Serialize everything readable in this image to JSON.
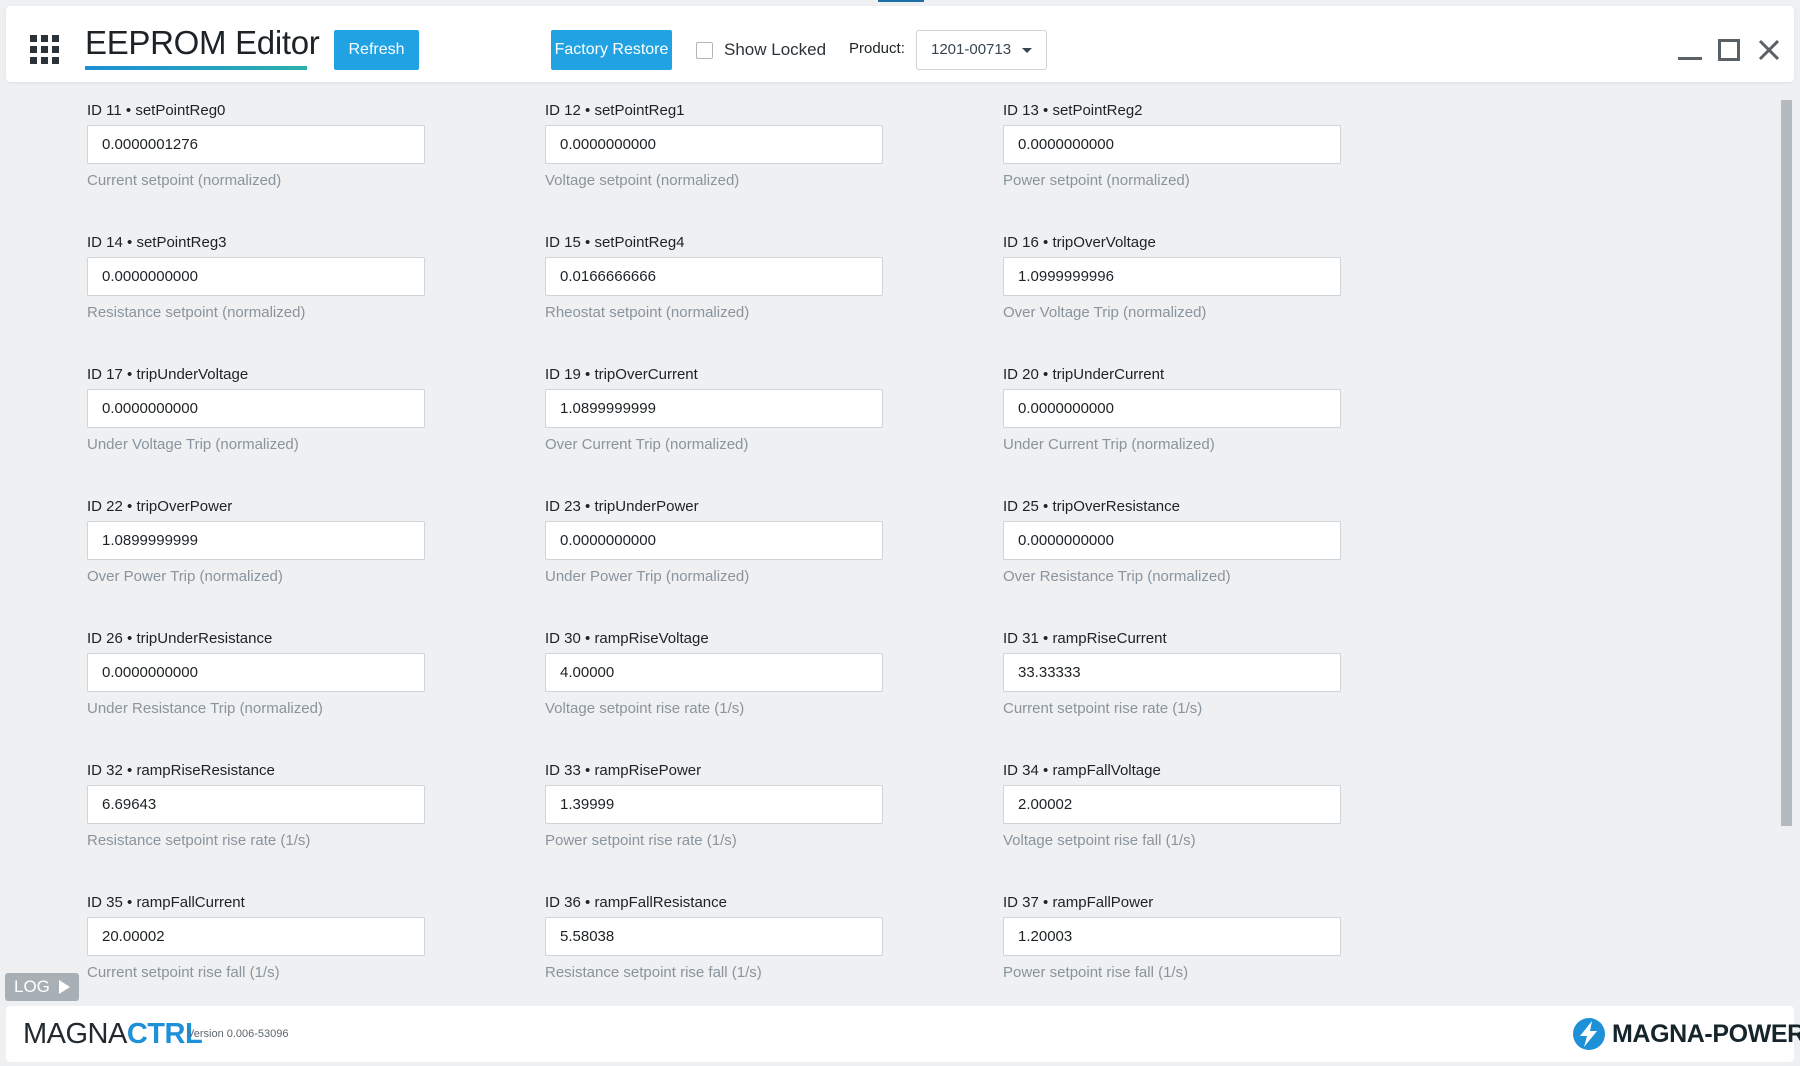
{
  "header": {
    "title": "EEPROM Editor",
    "refresh_label": "Refresh",
    "factory_restore_label": "Factory Restore",
    "show_locked_label": "Show Locked",
    "show_locked_checked": false,
    "product_label": "Product:",
    "product_value": "1201-00713"
  },
  "fields": [
    {
      "label": "ID 11 • setPointReg0",
      "value": "0.0000001276",
      "help": "Current setpoint (normalized)"
    },
    {
      "label": "ID 12 • setPointReg1",
      "value": "0.0000000000",
      "help": "Voltage setpoint (normalized)"
    },
    {
      "label": "ID 13 • setPointReg2",
      "value": "0.0000000000",
      "help": "Power setpoint (normalized)"
    },
    {
      "label": "ID 14 • setPointReg3",
      "value": "0.0000000000",
      "help": "Resistance setpoint (normalized)"
    },
    {
      "label": "ID 15 • setPointReg4",
      "value": "0.0166666666",
      "help": "Rheostat setpoint (normalized)"
    },
    {
      "label": "ID 16 • tripOverVoltage",
      "value": "1.0999999996",
      "help": "Over Voltage Trip (normalized)"
    },
    {
      "label": "ID 17 • tripUnderVoltage",
      "value": "0.0000000000",
      "help": "Under Voltage Trip (normalized)"
    },
    {
      "label": "ID 19 • tripOverCurrent",
      "value": "1.0899999999",
      "help": "Over Current Trip (normalized)"
    },
    {
      "label": "ID 20 • tripUnderCurrent",
      "value": "0.0000000000",
      "help": "Under Current Trip (normalized)"
    },
    {
      "label": "ID 22 • tripOverPower",
      "value": "1.0899999999",
      "help": "Over Power Trip (normalized)"
    },
    {
      "label": "ID 23 • tripUnderPower",
      "value": "0.0000000000",
      "help": "Under Power Trip (normalized)"
    },
    {
      "label": "ID 25 • tripOverResistance",
      "value": "0.0000000000",
      "help": "Over Resistance Trip (normalized)"
    },
    {
      "label": "ID 26 • tripUnderResistance",
      "value": "0.0000000000",
      "help": "Under Resistance Trip (normalized)"
    },
    {
      "label": "ID 30 • rampRiseVoltage",
      "value": "4.00000",
      "help": "Voltage setpoint rise rate (1/s)"
    },
    {
      "label": "ID 31 • rampRiseCurrent",
      "value": "33.33333",
      "help": "Current setpoint rise rate (1/s)"
    },
    {
      "label": "ID 32 • rampRiseResistance",
      "value": "6.69643",
      "help": "Resistance setpoint rise rate (1/s)"
    },
    {
      "label": "ID 33 • rampRisePower",
      "value": "1.39999",
      "help": "Power setpoint rise rate (1/s)"
    },
    {
      "label": "ID 34 • rampFallVoltage",
      "value": "2.00002",
      "help": "Voltage setpoint rise fall (1/s)"
    },
    {
      "label": "ID 35 • rampFallCurrent",
      "value": "20.00002",
      "help": "Current setpoint rise fall (1/s)"
    },
    {
      "label": "ID 36 • rampFallResistance",
      "value": "5.58038",
      "help": "Resistance setpoint rise fall (1/s)"
    },
    {
      "label": "ID 37 • rampFallPower",
      "value": "1.20003",
      "help": "Power setpoint rise fall (1/s)"
    }
  ],
  "log": {
    "label": "LOG"
  },
  "footer": {
    "brand_part1": "MAGNA",
    "brand_part2": "CTRL",
    "version": "Version 0.006-53096",
    "company": "MAGNA-POWER"
  },
  "colors": {
    "accent": "#21a3e3",
    "brand_blue": "#1d90d8",
    "help_text": "#8a949c"
  },
  "icons": {
    "app_menu": "grid-icon",
    "minimize": "minimize-icon",
    "maximize": "maximize-icon",
    "close": "close-icon",
    "dropdown": "chevron-down-icon",
    "log_toggle": "play-arrow-icon",
    "company_logo": "lightning-bolt-icon"
  }
}
